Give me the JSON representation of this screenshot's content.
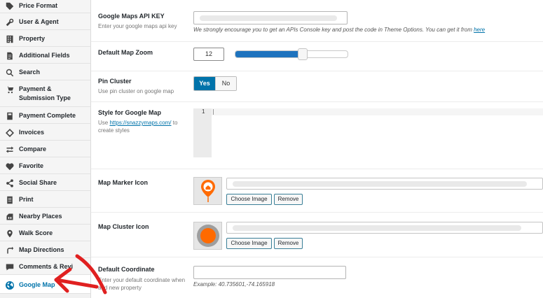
{
  "sidebar": {
    "items": [
      {
        "label": "Price Format",
        "icon": "tag-icon"
      },
      {
        "label": "User & Agent",
        "icon": "wrench-icon"
      },
      {
        "label": "Property",
        "icon": "building-icon"
      },
      {
        "label": "Additional Fields",
        "icon": "document-icon"
      },
      {
        "label": "Search",
        "icon": "search-icon"
      },
      {
        "label": "Payment & Submission Type",
        "icon": "cart-icon"
      },
      {
        "label": "Payment Complete",
        "icon": "page-icon"
      },
      {
        "label": "Invoices",
        "icon": "invoice-icon"
      },
      {
        "label": "Compare",
        "icon": "compare-icon"
      },
      {
        "label": "Favorite",
        "icon": "heart-icon"
      },
      {
        "label": "Social Share",
        "icon": "share-icon"
      },
      {
        "label": "Print",
        "icon": "print-icon"
      },
      {
        "label": "Nearby Places",
        "icon": "nearby-icon"
      },
      {
        "label": "Walk Score",
        "icon": "location-pin-icon"
      },
      {
        "label": "Map Directions",
        "icon": "redo-arrow-icon"
      },
      {
        "label": "Comments & Revi",
        "icon": "comment-icon"
      },
      {
        "label": "Google Map",
        "icon": "globe-icon"
      }
    ],
    "active_index": 16
  },
  "settings": {
    "api_key": {
      "title": "Google Maps API KEY",
      "desc": "Enter your google maps api key",
      "hint_text": "We strongly encourage you to get an APIs Console key and post the code in Theme Options. You can get it from",
      "hint_link": "here"
    },
    "zoom": {
      "title": "Default Map Zoom",
      "value": "12",
      "level_fraction": 0.6
    },
    "cluster": {
      "title": "Pin Cluster",
      "desc": "Use pin cluster on google map",
      "yes": "Yes",
      "no": "No",
      "selected": "Yes"
    },
    "style": {
      "title": "Style for Google Map",
      "desc_prefix": "Use",
      "desc_link": "https://snazzymaps.com/",
      "desc_suffix": "to create styles",
      "line_number": "1"
    },
    "marker_icon": {
      "title": "Map Marker Icon",
      "choose": "Choose Image",
      "remove": "Remove"
    },
    "cluster_icon": {
      "title": "Map Cluster Icon",
      "choose": "Choose Image",
      "remove": "Remove"
    },
    "coordinate": {
      "title": "Default Coordinate",
      "desc": "Enter your default coordinate when add new property",
      "example": "Example: 40.735601,-74.165918"
    }
  },
  "colors": {
    "accent": "#0073aa",
    "annotation_arrow": "#e02020",
    "marker_orange": "#ff6a00"
  }
}
